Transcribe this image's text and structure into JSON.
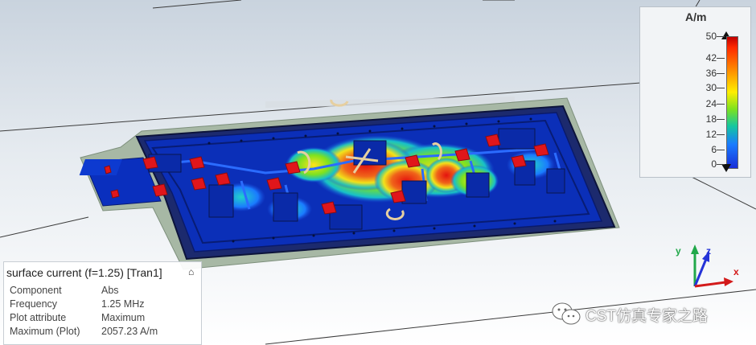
{
  "legend": {
    "unit": "A/m",
    "ticks": [
      "50",
      "42",
      "36",
      "30",
      "24",
      "18",
      "12",
      "6",
      "0"
    ],
    "colormap": [
      "#c00000",
      "#ff2a00",
      "#ff8a00",
      "#ffee00",
      "#7ee21f",
      "#15c7a0",
      "#1a7bff",
      "#1a2fd8"
    ]
  },
  "info": {
    "title": "surface current (f=1.25) [Tran1]",
    "rows": [
      {
        "key": "Component",
        "value": "Abs"
      },
      {
        "key": "Frequency",
        "value": "1.25 MHz"
      },
      {
        "key": "Plot attribute",
        "value": "Maximum"
      },
      {
        "key": "Maximum (Plot)",
        "value": "2057.23 A/m"
      }
    ]
  },
  "axes": {
    "x": "x",
    "y": "y",
    "z": "z",
    "colors": {
      "x": "#d31a1a",
      "y": "#21a84a",
      "z": "#2433d8"
    }
  },
  "watermark": {
    "text": "CST仿真专家之路"
  },
  "colors": {
    "board": "#0b2fb8",
    "substrate": "#9fb3a1",
    "hot": "#e01414",
    "background": "#e6ebf0"
  }
}
